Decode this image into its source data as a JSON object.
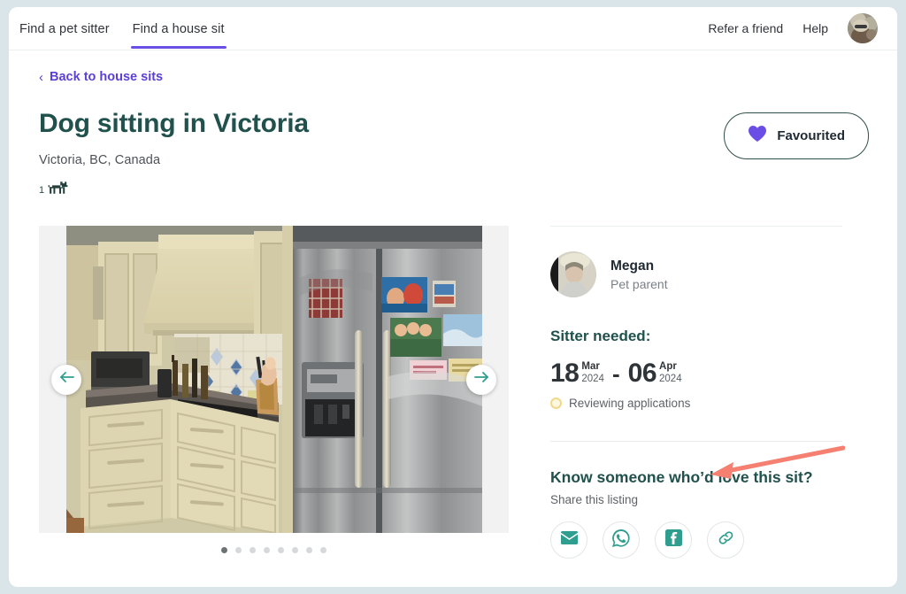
{
  "header": {
    "tabs": [
      {
        "label": "Find a pet sitter",
        "active": false
      },
      {
        "label": "Find a house sit",
        "active": true
      }
    ],
    "refer_label": "Refer a friend",
    "help_label": "Help",
    "avatar_name": "user-avatar"
  },
  "back_link": {
    "chevron": "‹",
    "label": "Back to house sits"
  },
  "listing": {
    "title": "Dog sitting in Victoria",
    "location": "Victoria, BC, Canada",
    "pet_count": "1",
    "pet_icon": "dog-icon"
  },
  "favourite": {
    "label": "Favourited",
    "icon": "heart-icon",
    "color": "#6b4ee6",
    "active": true
  },
  "carousel": {
    "prev_icon": "arrow-left-icon",
    "next_icon": "arrow-right-icon",
    "total_slides": 8,
    "active_slide": 1,
    "image_alt": "kitchen-photo"
  },
  "owner": {
    "name": "Megan",
    "role": "Pet parent"
  },
  "sitter": {
    "heading": "Sitter needed:",
    "start": {
      "day": "18",
      "month": "Mar",
      "year": "2024"
    },
    "separator": "-",
    "end": {
      "day": "06",
      "month": "Apr",
      "year": "2024"
    },
    "status": "Reviewing applications",
    "status_color": "#f0d98a"
  },
  "share": {
    "heading": "Know someone who’d love this sit?",
    "subtitle": "Share this listing",
    "buttons": [
      {
        "name": "email-share-button",
        "icon": "envelope-icon"
      },
      {
        "name": "whatsapp-share-button",
        "icon": "whatsapp-icon"
      },
      {
        "name": "facebook-share-button",
        "icon": "facebook-icon"
      },
      {
        "name": "copy-link-button",
        "icon": "link-icon"
      }
    ]
  },
  "theme": {
    "accent_purple": "#6b4ee6",
    "brand_green": "#20514c",
    "teal": "#2f9e8f",
    "annotation_red": "#f58071",
    "page_border": "#d9e5e8"
  }
}
